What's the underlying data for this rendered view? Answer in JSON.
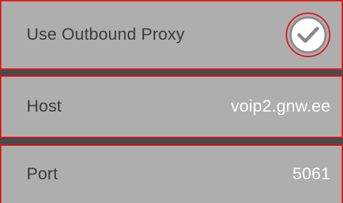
{
  "settings": {
    "use_outbound_proxy": {
      "label": "Use Outbound Proxy",
      "checked": true,
      "icon": "checkmark-circle-icon"
    },
    "host": {
      "label": "Host",
      "value": "voip2.gnw.ee"
    },
    "port": {
      "label": "Port",
      "value": "5061"
    }
  },
  "colors": {
    "row_background": "#aeaeae",
    "label_text": "#3c3c3c",
    "value_text": "#ffffff",
    "highlight_border": "#e01818",
    "separator": "#4a4a4a"
  }
}
